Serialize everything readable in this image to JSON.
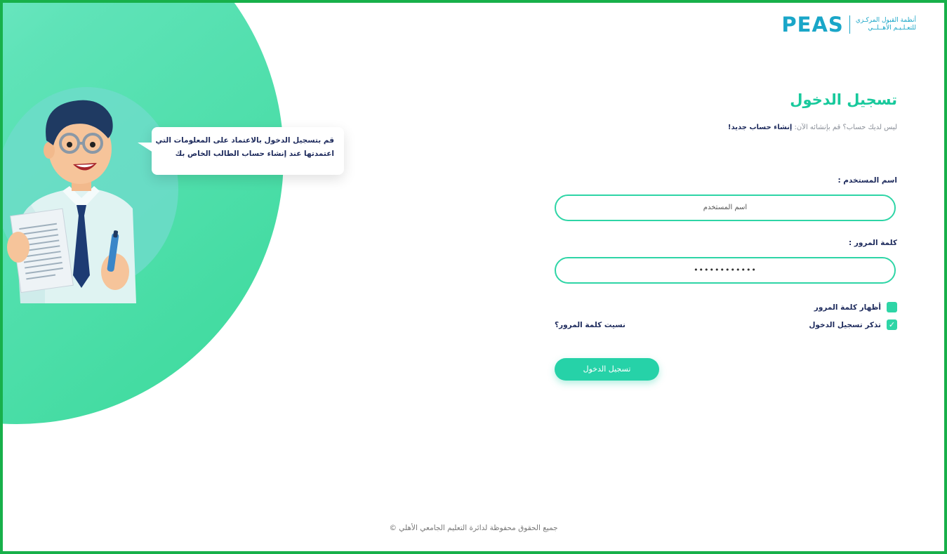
{
  "header": {
    "logo_text": "PEAS",
    "logo_sub_line1": "أنظمة القبول المركـزي",
    "logo_sub_line2": "للتعـلـيـم الأهــلــي"
  },
  "illustration": {
    "bubble_line1": "قم بتسجيل الدخول بالاعتماد على المعلومات التي",
    "bubble_line2": "اعتمدتها عند إنشاء حساب الطالب الخاص بك"
  },
  "login": {
    "title": "تسجيل الدخول",
    "subtitle_prefix": "ليس لديك حساب؟ قم بإنشائه الآن:",
    "create_account_link": "إنشاء حساب جديد!",
    "username_label": "اسم المستخدم :",
    "username_placeholder": "اسم المستخدم",
    "password_label": "كلمة المرور :",
    "password_value": "••••••••••••",
    "show_password_label": "أظهار كلمة المرور",
    "show_password_checked": false,
    "remember_me_label": "تذكر تسجيل الدخول",
    "remember_me_checked": true,
    "forgot_password_link": "نسيت كلمة المرور؟",
    "submit_label": "تسجيل الدخول"
  },
  "footer": {
    "copyright": "جميع الحقوق محفوظة لدائرة التعليم الجامعي الأهلي ©"
  },
  "colors": {
    "accent": "#2ed5a6",
    "navy": "#1d2a5c",
    "frame": "#17b04a",
    "logo": "#1aa6c8"
  }
}
